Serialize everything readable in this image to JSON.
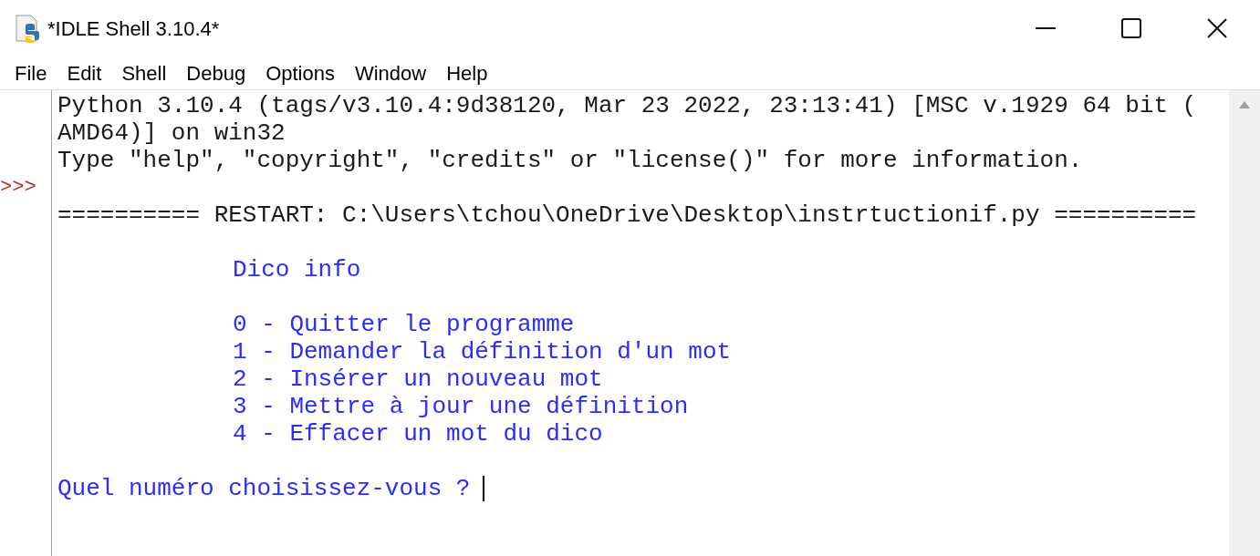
{
  "window": {
    "title": "*IDLE Shell 3.10.4*"
  },
  "menu": [
    "File",
    "Edit",
    "Shell",
    "Debug",
    "Options",
    "Window",
    "Help"
  ],
  "shell": {
    "lines": [
      {
        "kind": "header",
        "text": "Python 3.10.4 (tags/v3.10.4:9d38120, Mar 23 2022, 23:13:41) [MSC v.1929 64 bit ("
      },
      {
        "kind": "header",
        "text": "AMD64)] on win32"
      },
      {
        "kind": "header",
        "text": "Type \"help\", \"copyright\", \"credits\" or \"license()\" for more information."
      },
      {
        "kind": "blank",
        "prompt": ">>>"
      },
      {
        "kind": "header",
        "text": "========== RESTART: C:\\Users\\tchou\\OneDrive\\Desktop\\instrtuctionif.py =========="
      },
      {
        "kind": "blank"
      },
      {
        "kind": "output",
        "indented": true,
        "text": "Dico info"
      },
      {
        "kind": "blank"
      },
      {
        "kind": "output",
        "indented": true,
        "text": "0 - Quitter le programme"
      },
      {
        "kind": "output",
        "indented": true,
        "text": "1 - Demander la définition d'un mot"
      },
      {
        "kind": "output",
        "indented": true,
        "text": "2 - Insérer un nouveau mot"
      },
      {
        "kind": "output",
        "indented": true,
        "text": "3 - Mettre à jour une définition"
      },
      {
        "kind": "output",
        "indented": true,
        "text": "4 - Effacer un mot du dico"
      },
      {
        "kind": "blank"
      },
      {
        "kind": "output",
        "indented": false,
        "text": "Quel numéro choisissez-vous ?",
        "cursor": true
      }
    ]
  }
}
